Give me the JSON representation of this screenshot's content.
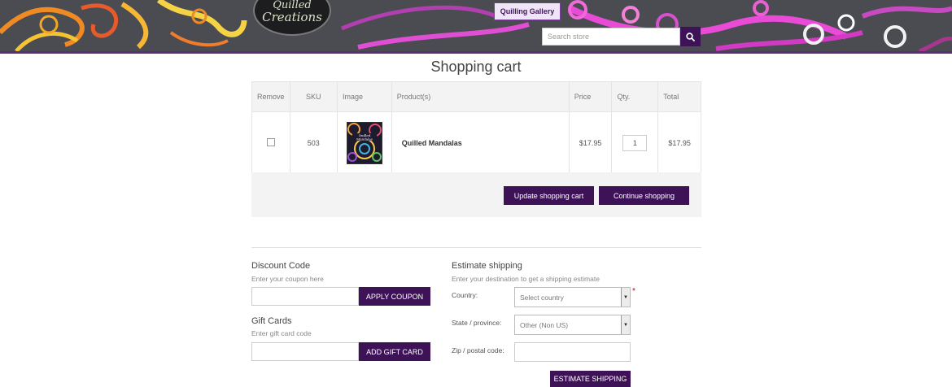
{
  "header": {
    "logo_line1": "Quilled",
    "logo_line2": "Creations",
    "gallery_label": "Quilling Gallery",
    "search_placeholder": "Search store",
    "search_icon": "search-icon"
  },
  "page": {
    "title": "Shopping cart"
  },
  "cart": {
    "columns": [
      "Remove",
      "SKU",
      "Image",
      "Product(s)",
      "Price",
      "Qty.",
      "Total"
    ],
    "rows": [
      {
        "sku": "503",
        "product": "Quilled Mandalas",
        "price": "$17.95",
        "qty": "1",
        "total": "$17.95"
      }
    ],
    "update_label": "Update shopping cart",
    "continue_label": "Continue shopping"
  },
  "discount": {
    "title": "Discount Code",
    "hint": "Enter your coupon here",
    "button": "APPLY COUPON"
  },
  "gift": {
    "title": "Gift Cards",
    "hint": "Enter gift card code",
    "button": "ADD GIFT CARD"
  },
  "shipping": {
    "title": "Estimate shipping",
    "hint": "Enter your destination to get a shipping estimate",
    "country_label": "Country:",
    "country_value": "Select country",
    "required_mark": "*",
    "state_label": "State / province:",
    "state_value": "Other (Non US)",
    "zip_label": "Zip / postal code:",
    "button": "ESTIMATE SHIPPING"
  },
  "colors": {
    "accent": "#3d1257",
    "banner": "#4a4c52",
    "strip": "#5b2f73"
  }
}
